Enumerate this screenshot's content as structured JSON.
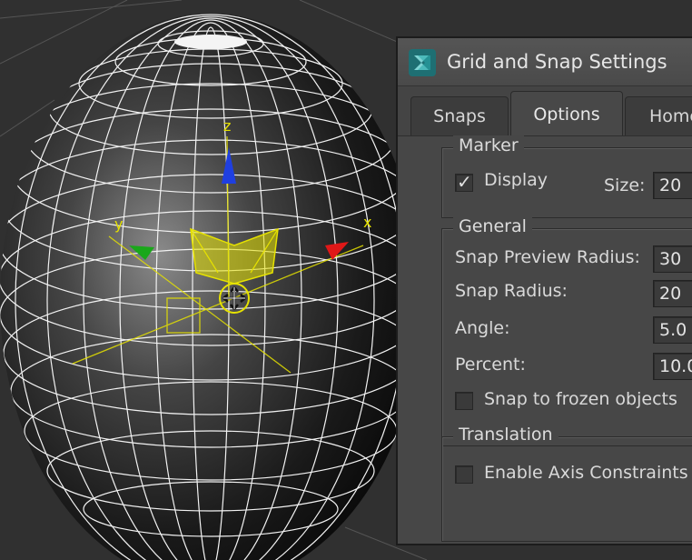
{
  "dialog": {
    "title": "Grid and Snap Settings",
    "tabs": [
      {
        "label": "Snaps",
        "active": false
      },
      {
        "label": "Options",
        "active": true
      },
      {
        "label": "Home",
        "active": false
      }
    ],
    "marker": {
      "label": "Marker",
      "display_label": "Display",
      "display_checked": true,
      "size_label": "Size:",
      "size_value": "20"
    },
    "general": {
      "label": "General",
      "snap_preview_radius_label": "Snap Preview Radius:",
      "snap_preview_radius_value": "30",
      "snap_radius_label": "Snap Radius:",
      "snap_radius_value": "20",
      "angle_label": "Angle:",
      "angle_value": "5.0",
      "percent_label": "Percent:",
      "percent_value": "10.0",
      "snap_frozen_label": "Snap to frozen objects",
      "snap_frozen_checked": false
    },
    "translation": {
      "label": "Translation",
      "axis_constraints_label": "Enable Axis Constraints",
      "axis_constraints_checked": false
    }
  },
  "viewport": {
    "axis_labels": {
      "x": "x",
      "y": "y",
      "z": "z"
    },
    "colors": {
      "x_axis": "#e01818",
      "y_axis": "#1aa81a",
      "z_axis": "#1f3fe0",
      "gizmo": "#e6e200",
      "wire": "#f2f2f2"
    }
  }
}
